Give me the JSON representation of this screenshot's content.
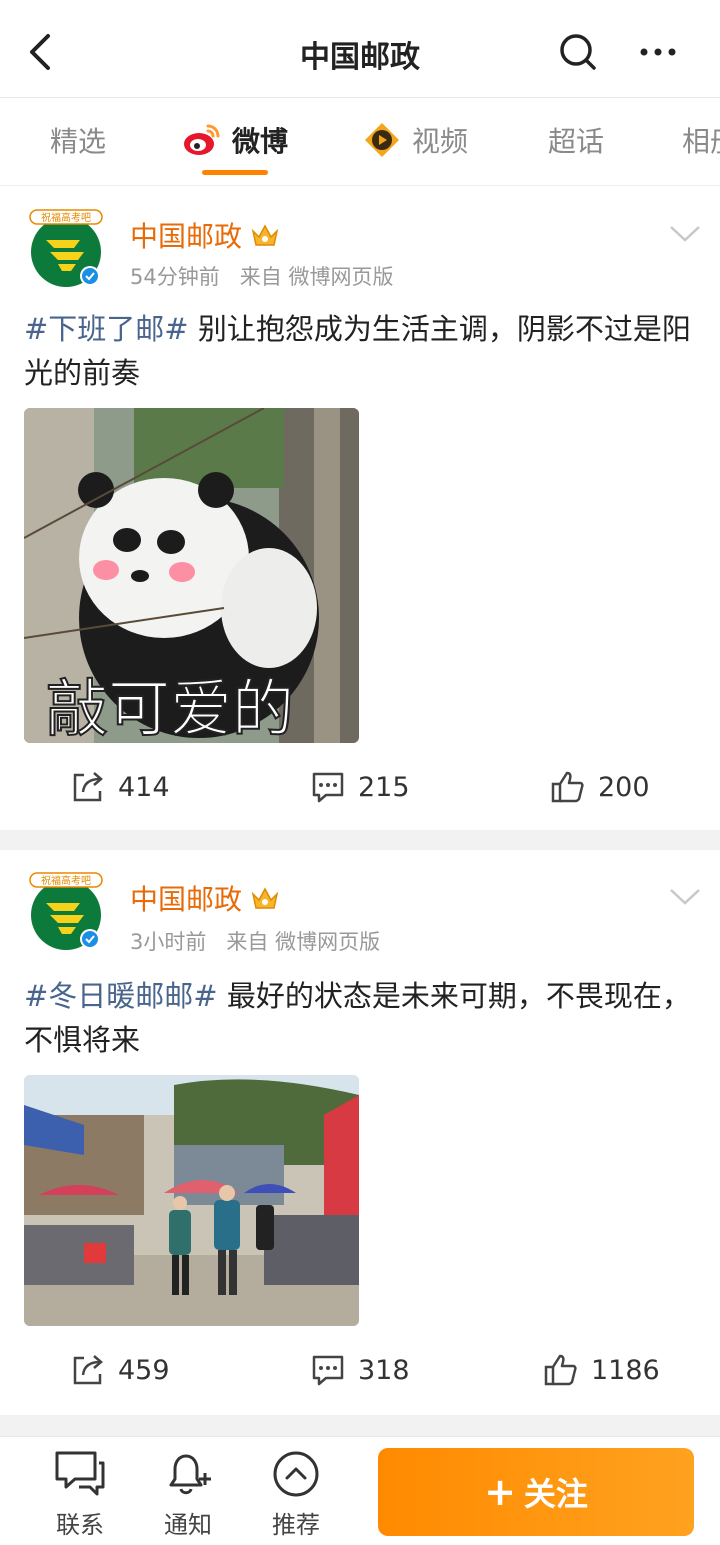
{
  "nav": {
    "title": "中国邮政"
  },
  "tabs": [
    {
      "label": "精选"
    },
    {
      "label": "微博"
    },
    {
      "label": "视频"
    },
    {
      "label": "超话"
    },
    {
      "label": "相册"
    }
  ],
  "posts": [
    {
      "author": "中国邮政",
      "avatar_banner": "祝福高考吧",
      "time": "54分钟前",
      "source": "来自 微博网页版",
      "hashtag": "#下班了邮#",
      "text": " 别让抱怨成为生活主调，阴影不过是阳光的前奏",
      "image_caption": "敲可爱的",
      "reposts": "414",
      "comments": "215",
      "likes": "200"
    },
    {
      "author": "中国邮政",
      "avatar_banner": "祝福高考吧",
      "time": "3小时前",
      "source": "来自 微博网页版",
      "hashtag": "#冬日暖邮邮#",
      "text": " 最好的状态是未来可期，不畏现在，不惧将来",
      "reposts": "459",
      "comments": "318",
      "likes": "1186"
    }
  ],
  "bottom_bar": {
    "contact": "联系",
    "notify": "通知",
    "recommend": "推荐",
    "follow": "关注"
  },
  "colors": {
    "accent": "#ff8200",
    "author": "#e86b0a",
    "hashtag": "#49658e",
    "follow_bg": "#ff8a00"
  }
}
